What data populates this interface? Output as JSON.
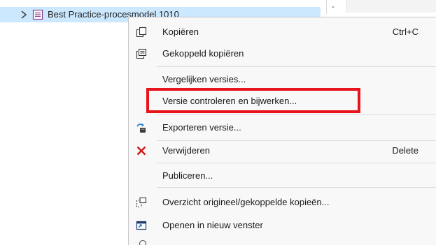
{
  "tree": {
    "node_label": "Best Practice-procesmodel 1010",
    "chevron_icon": "chevron-right-icon",
    "node_icon": "process-model-icon"
  },
  "side_panel": {
    "dash_text": "-"
  },
  "context_menu": {
    "items": [
      {
        "label": "Kopiëren",
        "shortcut": "Ctrl+C",
        "icon": "copy-icon"
      },
      {
        "label": "Gekoppeld kopiëren",
        "shortcut": "",
        "icon": "linked-copy-icon"
      },
      {
        "label": "Vergelijken versies...",
        "shortcut": "",
        "icon": ""
      },
      {
        "label": "Versie controleren en bijwerken...",
        "shortcut": "",
        "icon": ""
      },
      {
        "label": "Exporteren versie...",
        "shortcut": "",
        "icon": "export-icon"
      },
      {
        "label": "Verwijderen",
        "shortcut": "Delete",
        "icon": "delete-icon"
      },
      {
        "label": "Publiceren...",
        "shortcut": "",
        "icon": ""
      },
      {
        "label": "Overzicht origineel/gekoppelde kopieën...",
        "shortcut": "",
        "icon": "linked-copies-overview-icon"
      },
      {
        "label": "Openen in nieuw venster",
        "shortcut": "",
        "icon": "new-window-icon"
      }
    ]
  },
  "colors": {
    "selection": "#cce8ff",
    "highlight_border": "#e8141b",
    "menu_background": "#f8f8f8",
    "delete_icon": "#d11a1a"
  }
}
